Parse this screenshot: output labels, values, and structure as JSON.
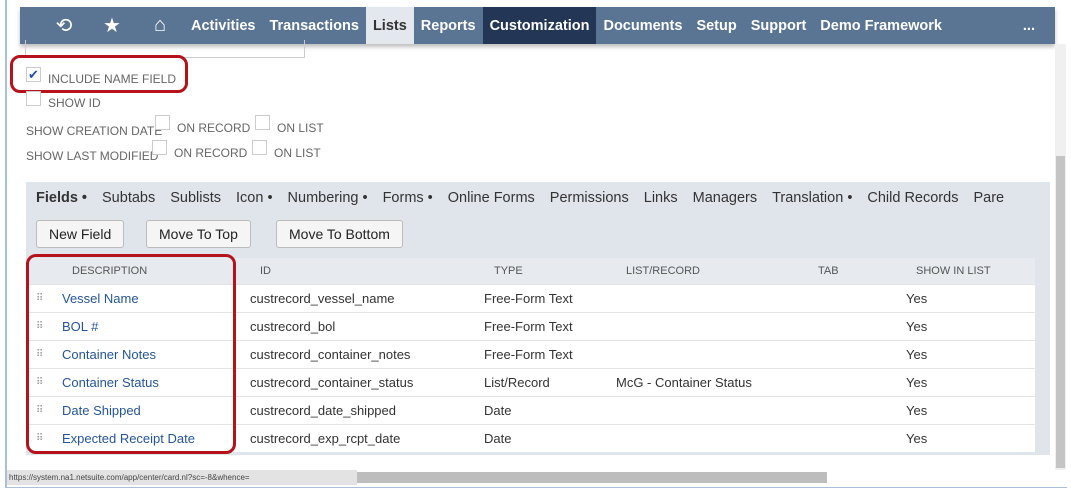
{
  "nav": {
    "icons": [
      "recent-icon",
      "star-icon",
      "home-icon"
    ],
    "items": [
      "Activities",
      "Transactions",
      "Lists",
      "Reports",
      "Customization",
      "Documents",
      "Setup",
      "Support",
      "Demo Framework"
    ],
    "more": "..."
  },
  "options": {
    "include_name": "INCLUDE NAME FIELD",
    "include_name_checked": true,
    "show_id": "SHOW ID",
    "show_creation": "SHOW CREATION DATE",
    "show_modified": "SHOW LAST MODIFIED",
    "on_record": "ON RECORD",
    "on_list": "ON LIST"
  },
  "tabs": [
    "Fields •",
    "Subtabs",
    "Sublists",
    "Icon •",
    "Numbering •",
    "Forms •",
    "Online Forms",
    "Permissions",
    "Links",
    "Managers",
    "Translation •",
    "Child Records",
    "Pare"
  ],
  "buttons": {
    "new_field": "New Field",
    "move_top": "Move To Top",
    "move_bottom": "Move To Bottom"
  },
  "table": {
    "headers": [
      "DESCRIPTION",
      "ID",
      "TYPE",
      "LIST/RECORD",
      "TAB",
      "SHOW IN LIST"
    ],
    "rows": [
      [
        "Vessel Name",
        "custrecord_vessel_name",
        "Free-Form Text",
        "",
        "",
        "Yes"
      ],
      [
        "BOL #",
        "custrecord_bol",
        "Free-Form Text",
        "",
        "",
        "Yes"
      ],
      [
        "Container Notes",
        "custrecord_container_notes",
        "Free-Form Text",
        "",
        "",
        "Yes"
      ],
      [
        "Container Status",
        "custrecord_container_status",
        "List/Record",
        "McG - Container Status",
        "",
        "Yes"
      ],
      [
        "Date Shipped",
        "custrecord_date_shipped",
        "Date",
        "",
        "",
        "Yes"
      ],
      [
        "Expected Receipt Date",
        "custrecord_exp_rcpt_date",
        "Date",
        "",
        "",
        "Yes"
      ]
    ]
  },
  "status_url": "https://system.na1.netsuite.com/app/center/card.nl?sc=-8&whence=",
  "colors": {
    "nav": "#5a7494",
    "active_dark": "#243656",
    "highlight": "#b5121b",
    "link": "#255599"
  }
}
